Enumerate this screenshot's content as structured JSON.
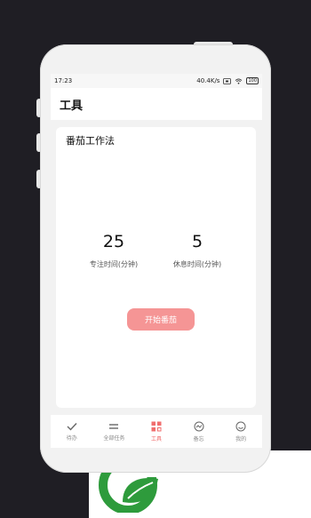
{
  "status_bar": {
    "time": "17:23",
    "network_speed": "40.4K/s",
    "battery": "100"
  },
  "header": {
    "title": "工具"
  },
  "pomodoro": {
    "title": "番茄工作法",
    "focus_minutes": "25",
    "focus_label": "专注时间(分钟)",
    "rest_minutes": "5",
    "rest_label": "休息时间(分钟)",
    "start_label": "开始番茄"
  },
  "tabs": [
    {
      "label": "待办",
      "icon": "check-icon",
      "active": false
    },
    {
      "label": "全部任务",
      "icon": "list-icon",
      "active": false
    },
    {
      "label": "工具",
      "icon": "grid-icon",
      "active": true
    },
    {
      "label": "备忘",
      "icon": "memo-icon",
      "active": false
    },
    {
      "label": "我的",
      "icon": "profile-icon",
      "active": false
    }
  ],
  "colors": {
    "accent": "#f06e6e",
    "button": "#f59595",
    "logo_green": "#2e9b3c"
  }
}
